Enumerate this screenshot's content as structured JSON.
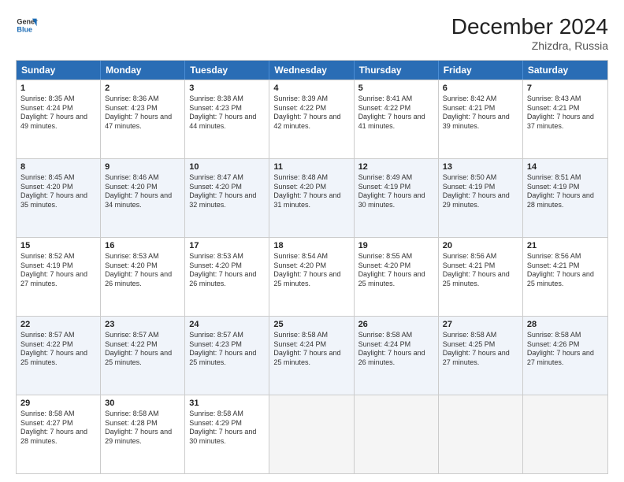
{
  "header": {
    "logo_line1": "General",
    "logo_line2": "Blue",
    "month": "December 2024",
    "location": "Zhizdra, Russia"
  },
  "days_of_week": [
    "Sunday",
    "Monday",
    "Tuesday",
    "Wednesday",
    "Thursday",
    "Friday",
    "Saturday"
  ],
  "weeks": [
    [
      {
        "day": "1",
        "sunrise": "Sunrise: 8:35 AM",
        "sunset": "Sunset: 4:24 PM",
        "daylight": "Daylight: 7 hours and 49 minutes."
      },
      {
        "day": "2",
        "sunrise": "Sunrise: 8:36 AM",
        "sunset": "Sunset: 4:23 PM",
        "daylight": "Daylight: 7 hours and 47 minutes."
      },
      {
        "day": "3",
        "sunrise": "Sunrise: 8:38 AM",
        "sunset": "Sunset: 4:23 PM",
        "daylight": "Daylight: 7 hours and 44 minutes."
      },
      {
        "day": "4",
        "sunrise": "Sunrise: 8:39 AM",
        "sunset": "Sunset: 4:22 PM",
        "daylight": "Daylight: 7 hours and 42 minutes."
      },
      {
        "day": "5",
        "sunrise": "Sunrise: 8:41 AM",
        "sunset": "Sunset: 4:22 PM",
        "daylight": "Daylight: 7 hours and 41 minutes."
      },
      {
        "day": "6",
        "sunrise": "Sunrise: 8:42 AM",
        "sunset": "Sunset: 4:21 PM",
        "daylight": "Daylight: 7 hours and 39 minutes."
      },
      {
        "day": "7",
        "sunrise": "Sunrise: 8:43 AM",
        "sunset": "Sunset: 4:21 PM",
        "daylight": "Daylight: 7 hours and 37 minutes."
      }
    ],
    [
      {
        "day": "8",
        "sunrise": "Sunrise: 8:45 AM",
        "sunset": "Sunset: 4:20 PM",
        "daylight": "Daylight: 7 hours and 35 minutes."
      },
      {
        "day": "9",
        "sunrise": "Sunrise: 8:46 AM",
        "sunset": "Sunset: 4:20 PM",
        "daylight": "Daylight: 7 hours and 34 minutes."
      },
      {
        "day": "10",
        "sunrise": "Sunrise: 8:47 AM",
        "sunset": "Sunset: 4:20 PM",
        "daylight": "Daylight: 7 hours and 32 minutes."
      },
      {
        "day": "11",
        "sunrise": "Sunrise: 8:48 AM",
        "sunset": "Sunset: 4:20 PM",
        "daylight": "Daylight: 7 hours and 31 minutes."
      },
      {
        "day": "12",
        "sunrise": "Sunrise: 8:49 AM",
        "sunset": "Sunset: 4:19 PM",
        "daylight": "Daylight: 7 hours and 30 minutes."
      },
      {
        "day": "13",
        "sunrise": "Sunrise: 8:50 AM",
        "sunset": "Sunset: 4:19 PM",
        "daylight": "Daylight: 7 hours and 29 minutes."
      },
      {
        "day": "14",
        "sunrise": "Sunrise: 8:51 AM",
        "sunset": "Sunset: 4:19 PM",
        "daylight": "Daylight: 7 hours and 28 minutes."
      }
    ],
    [
      {
        "day": "15",
        "sunrise": "Sunrise: 8:52 AM",
        "sunset": "Sunset: 4:19 PM",
        "daylight": "Daylight: 7 hours and 27 minutes."
      },
      {
        "day": "16",
        "sunrise": "Sunrise: 8:53 AM",
        "sunset": "Sunset: 4:20 PM",
        "daylight": "Daylight: 7 hours and 26 minutes."
      },
      {
        "day": "17",
        "sunrise": "Sunrise: 8:53 AM",
        "sunset": "Sunset: 4:20 PM",
        "daylight": "Daylight: 7 hours and 26 minutes."
      },
      {
        "day": "18",
        "sunrise": "Sunrise: 8:54 AM",
        "sunset": "Sunset: 4:20 PM",
        "daylight": "Daylight: 7 hours and 25 minutes."
      },
      {
        "day": "19",
        "sunrise": "Sunrise: 8:55 AM",
        "sunset": "Sunset: 4:20 PM",
        "daylight": "Daylight: 7 hours and 25 minutes."
      },
      {
        "day": "20",
        "sunrise": "Sunrise: 8:56 AM",
        "sunset": "Sunset: 4:21 PM",
        "daylight": "Daylight: 7 hours and 25 minutes."
      },
      {
        "day": "21",
        "sunrise": "Sunrise: 8:56 AM",
        "sunset": "Sunset: 4:21 PM",
        "daylight": "Daylight: 7 hours and 25 minutes."
      }
    ],
    [
      {
        "day": "22",
        "sunrise": "Sunrise: 8:57 AM",
        "sunset": "Sunset: 4:22 PM",
        "daylight": "Daylight: 7 hours and 25 minutes."
      },
      {
        "day": "23",
        "sunrise": "Sunrise: 8:57 AM",
        "sunset": "Sunset: 4:22 PM",
        "daylight": "Daylight: 7 hours and 25 minutes."
      },
      {
        "day": "24",
        "sunrise": "Sunrise: 8:57 AM",
        "sunset": "Sunset: 4:23 PM",
        "daylight": "Daylight: 7 hours and 25 minutes."
      },
      {
        "day": "25",
        "sunrise": "Sunrise: 8:58 AM",
        "sunset": "Sunset: 4:24 PM",
        "daylight": "Daylight: 7 hours and 25 minutes."
      },
      {
        "day": "26",
        "sunrise": "Sunrise: 8:58 AM",
        "sunset": "Sunset: 4:24 PM",
        "daylight": "Daylight: 7 hours and 26 minutes."
      },
      {
        "day": "27",
        "sunrise": "Sunrise: 8:58 AM",
        "sunset": "Sunset: 4:25 PM",
        "daylight": "Daylight: 7 hours and 27 minutes."
      },
      {
        "day": "28",
        "sunrise": "Sunrise: 8:58 AM",
        "sunset": "Sunset: 4:26 PM",
        "daylight": "Daylight: 7 hours and 27 minutes."
      }
    ],
    [
      {
        "day": "29",
        "sunrise": "Sunrise: 8:58 AM",
        "sunset": "Sunset: 4:27 PM",
        "daylight": "Daylight: 7 hours and 28 minutes."
      },
      {
        "day": "30",
        "sunrise": "Sunrise: 8:58 AM",
        "sunset": "Sunset: 4:28 PM",
        "daylight": "Daylight: 7 hours and 29 minutes."
      },
      {
        "day": "31",
        "sunrise": "Sunrise: 8:58 AM",
        "sunset": "Sunset: 4:29 PM",
        "daylight": "Daylight: 7 hours and 30 minutes."
      },
      {
        "day": "",
        "sunrise": "",
        "sunset": "",
        "daylight": ""
      },
      {
        "day": "",
        "sunrise": "",
        "sunset": "",
        "daylight": ""
      },
      {
        "day": "",
        "sunrise": "",
        "sunset": "",
        "daylight": ""
      },
      {
        "day": "",
        "sunrise": "",
        "sunset": "",
        "daylight": ""
      }
    ]
  ]
}
